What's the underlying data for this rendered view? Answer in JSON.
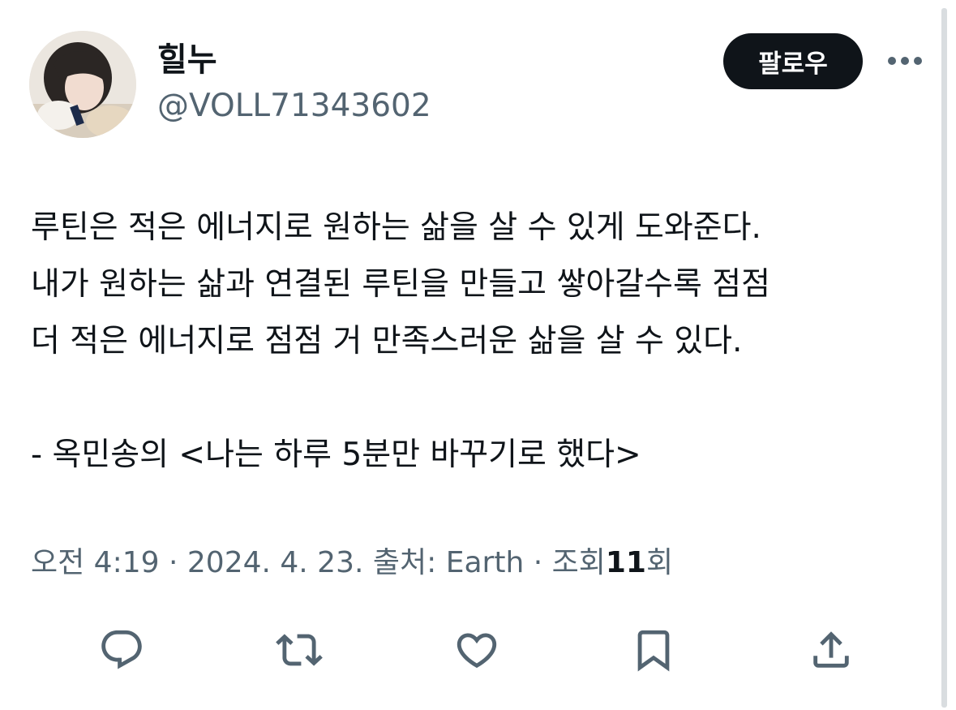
{
  "user": {
    "display_name": "힐누",
    "handle": "@VOLL71343602",
    "avatar": "profile-photo"
  },
  "follow_button": {
    "label": "팔로우"
  },
  "more_icon": "ellipsis-icon",
  "tweet": {
    "lines": [
      "루틴은 적은 에너지로 원하는 삶을 살 수 있게 도와준다.",
      "내가 원하는 삶과 연결된 루틴을 만들고 쌓아갈수록 점점",
      "더 적은 에너지로 점점 거 만족스러운 삶을 살 수 있다.",
      "",
      "- 옥민송의 <나는 하루 5분만 바꾸기로 했다>"
    ]
  },
  "meta": {
    "time": "오전 4:19",
    "separator": "·",
    "date": "2024. 4. 23.",
    "source_label": "출처:",
    "source": "Earth",
    "views_label": "조회",
    "views_count": "11",
    "views_suffix": "회"
  },
  "actions": [
    "reply-icon",
    "retweet-icon",
    "like-icon",
    "bookmark-icon",
    "share-icon"
  ],
  "colors": {
    "text": "#0f1419",
    "secondary": "#536471",
    "button_bg": "#0f1419",
    "button_text": "#ffffff",
    "background": "#ffffff"
  }
}
